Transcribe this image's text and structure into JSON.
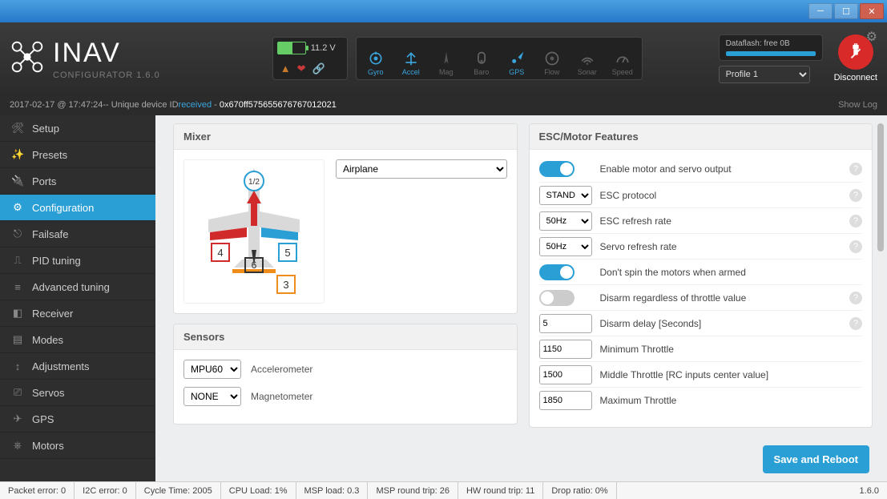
{
  "window": {
    "title_hidden": ""
  },
  "app": {
    "name": "INAV",
    "tagline": "CONFIGURATOR  1.6.0"
  },
  "battery": {
    "voltage": "11.2 V"
  },
  "sensors_top": [
    {
      "id": "gyro",
      "label": "Gyro",
      "on": true
    },
    {
      "id": "accel",
      "label": "Accel",
      "on": true
    },
    {
      "id": "mag",
      "label": "Mag",
      "on": false
    },
    {
      "id": "baro",
      "label": "Baro",
      "on": false
    },
    {
      "id": "gps",
      "label": "GPS",
      "on": true
    },
    {
      "id": "flow",
      "label": "Flow",
      "on": false
    },
    {
      "id": "sonar",
      "label": "Sonar",
      "on": false
    },
    {
      "id": "speed",
      "label": "Speed",
      "on": false
    }
  ],
  "dataflash": {
    "label": "Dataflash: free 0B"
  },
  "profile": {
    "selected": "Profile 1"
  },
  "disconnect_label": "Disconnect",
  "status_strip": {
    "timestamp": "2017-02-17 @ 17:47:24",
    "sep": " -- Unique device ID ",
    "received": "received",
    "devid": "0x670ff575655676767012021",
    "showlog": "Show Log"
  },
  "sidebar": [
    {
      "label": "Setup",
      "icon": "🛠"
    },
    {
      "label": "Presets",
      "icon": "✨"
    },
    {
      "label": "Ports",
      "icon": "🔌"
    },
    {
      "label": "Configuration",
      "icon": "⚙"
    },
    {
      "label": "Failsafe",
      "icon": "⎋"
    },
    {
      "label": "PID tuning",
      "icon": "⎍"
    },
    {
      "label": "Advanced tuning",
      "icon": "≡"
    },
    {
      "label": "Receiver",
      "icon": "◧"
    },
    {
      "label": "Modes",
      "icon": "▤"
    },
    {
      "label": "Adjustments",
      "icon": "↕"
    },
    {
      "label": "Servos",
      "icon": "⎚"
    },
    {
      "label": "GPS",
      "icon": "✈"
    },
    {
      "label": "Motors",
      "icon": "⎈"
    }
  ],
  "sidebar_active_index": 3,
  "mixer": {
    "title": "Mixer",
    "type": "Airplane",
    "channel_labels": {
      "top": "1/2",
      "left": "4",
      "right": "5",
      "tail": "6",
      "bottom": "3"
    }
  },
  "sensors_panel": {
    "title": "Sensors",
    "rows": [
      {
        "value": "MPU60",
        "label": "Accelerometer"
      },
      {
        "value": "NONE",
        "label": "Magnetometer"
      }
    ]
  },
  "esc": {
    "title": "ESC/Motor Features",
    "rows": [
      {
        "kind": "toggle",
        "on": true,
        "label": "Enable motor and servo output",
        "help": true
      },
      {
        "kind": "select",
        "value": "STAND",
        "label": "ESC protocol",
        "help": true
      },
      {
        "kind": "select",
        "value": "50Hz",
        "label": "ESC refresh rate",
        "help": true
      },
      {
        "kind": "select",
        "value": "50Hz",
        "label": "Servo refresh rate",
        "help": true
      },
      {
        "kind": "toggle",
        "on": true,
        "label": "Don't spin the motors when armed",
        "help": false
      },
      {
        "kind": "toggle",
        "on": false,
        "label": "Disarm regardless of throttle value",
        "help": true
      },
      {
        "kind": "number",
        "value": "5",
        "label": "Disarm delay [Seconds]",
        "help": true
      },
      {
        "kind": "number",
        "value": "1150",
        "label": "Minimum Throttle",
        "help": false
      },
      {
        "kind": "number",
        "value": "1500",
        "label": "Middle Throttle [RC inputs center value]",
        "help": false
      },
      {
        "kind": "number",
        "value": "1850",
        "label": "Maximum Throttle",
        "help": false
      }
    ]
  },
  "save_label": "Save and Reboot",
  "bottom": {
    "cells": [
      "Packet error: 0",
      "I2C error: 0",
      "Cycle Time: 2005",
      "CPU Load: 1%",
      "MSP load: 0.3",
      "MSP round trip: 26",
      "HW round trip: 11",
      "Drop ratio: 0%"
    ],
    "version": "1.6.0"
  }
}
